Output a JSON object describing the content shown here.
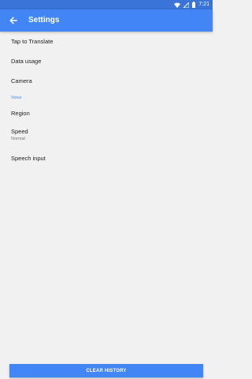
{
  "status_bar": {
    "time": "7:21",
    "icons": [
      "wifi-icon",
      "signal-icon",
      "battery-icon"
    ]
  },
  "app_bar": {
    "title": "Settings",
    "back_icon": "arrow-back-icon",
    "color": "#4285f4"
  },
  "settings": {
    "tap_to_translate": "Tap to Translate",
    "data_usage": "Data usage",
    "camera": "Camera",
    "voice_section": "Voice",
    "region": "Region",
    "speed_label": "Speed",
    "speed_value": "Normal",
    "speech_input": "Speech input"
  },
  "footer": {
    "clear_history": "CLEAR HISTORY"
  },
  "colors": {
    "accent": "#4285f4",
    "status_bar": "#3a74d8",
    "background": "#f1f1f1"
  }
}
